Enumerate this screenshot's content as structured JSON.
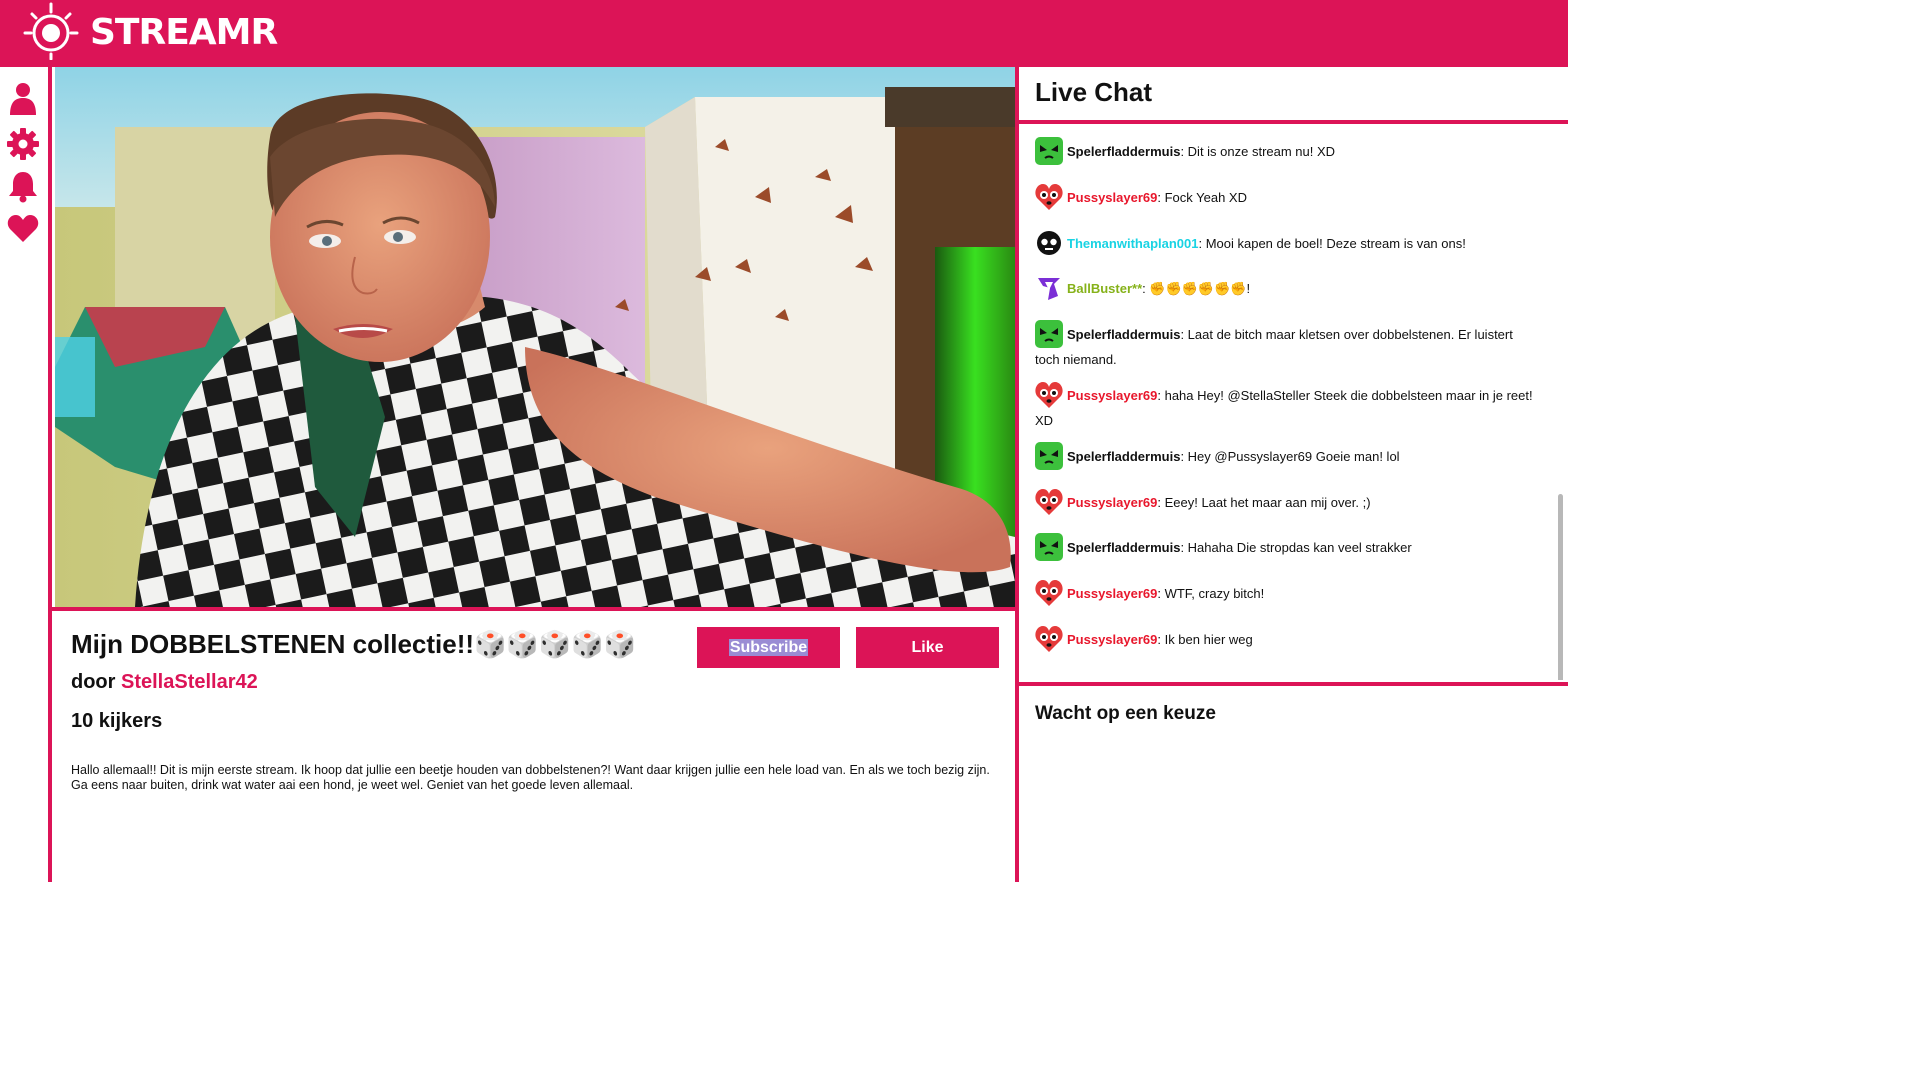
{
  "colors": {
    "brand": "#dc1457",
    "text": "#111111",
    "username_red": "#e8172c",
    "username_cyan": "#19d3e3",
    "username_olive": "#86b21a",
    "highlight": "#9a8cd4"
  },
  "header": {
    "brand": "STREAMR",
    "logo_icon": "streamr-logo-icon"
  },
  "sidebar": {
    "items": [
      {
        "icon": "profile-icon"
      },
      {
        "icon": "gear-icon"
      },
      {
        "icon": "bell-icon"
      },
      {
        "icon": "heart-icon"
      }
    ]
  },
  "video": {
    "description": "webcam-video-frame"
  },
  "stream": {
    "title": "Mijn DOBBELSTENEN collectie!!🎲🎲🎲🎲🎲",
    "by_prefix": "door",
    "author": "StellaStellar42",
    "viewers": "10 kijkers",
    "description": "Hallo allemaal!! Dit is mijn eerste stream. Ik hoop dat jullie een beetje houden van dobbelstenen?! Want daar krijgen jullie een hele load van. En als we toch bezig zijn. Ga eens naar buiten, drink wat water aai een hond, je weet wel. Geniet van het goede leven allemaal.",
    "subscribe_label": "Subscribe",
    "like_label": "Like"
  },
  "chat": {
    "title": "Live Chat",
    "messages": [
      {
        "user": "Spelerfladdermuis",
        "avatar": "alien-icon",
        "text": ": Dit is onze stream nu! XD"
      },
      {
        "user": "Pussyslayer69",
        "avatar": "heart-face-icon",
        "text": ": Fock Yeah XD"
      },
      {
        "user": "Themanwithaplan001",
        "avatar": "skull-icon",
        "text": ": Mooi kapen de boel! Deze stream is van ons!"
      },
      {
        "user": "BallBuster**",
        "avatar": "crown-icon",
        "text": ": ✊✊✊✊✊✊!"
      },
      {
        "user": "Spelerfladdermuis",
        "avatar": "alien-icon",
        "text": ": Laat de bitch maar kletsen over dobbelstenen. Er luistert toch niemand."
      },
      {
        "user": "Pussyslayer69",
        "avatar": "heart-face-icon",
        "text": ": haha Hey! @StellaSteller Steek die dobbelsteen maar in je reet! XD"
      },
      {
        "user": "Spelerfladdermuis",
        "avatar": "alien-icon",
        "text": ": Hey @Pussyslayer69 Goeie man! lol"
      },
      {
        "user": "Pussyslayer69",
        "avatar": "heart-face-icon",
        "text": ": Eeey! Laat het maar aan mij over. ;)"
      },
      {
        "user": "Spelerfladdermuis",
        "avatar": "alien-icon",
        "text": ": Hahaha Die stropdas kan veel strakker"
      },
      {
        "user": "Pussyslayer69",
        "avatar": "heart-face-icon",
        "text": ": WTF, crazy bitch!"
      },
      {
        "user": "Pussyslayer69",
        "avatar": "heart-face-icon",
        "text": ": Ik ben hier weg"
      }
    ],
    "poll_title": "Wacht op een keuze"
  }
}
